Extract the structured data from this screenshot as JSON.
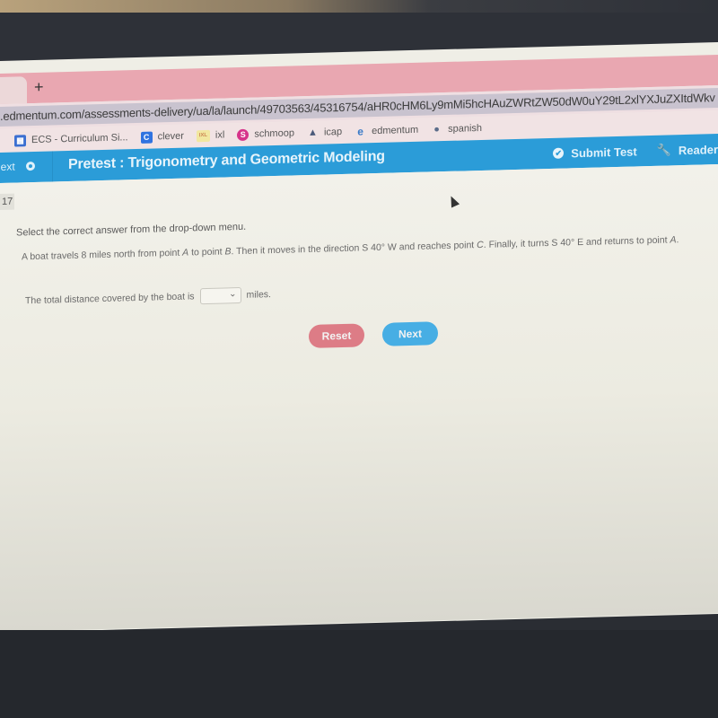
{
  "browser": {
    "tab_close_icon": "close-icon",
    "new_tab_icon": "plus-icon",
    "url": ".edmentum.com/assessments-delivery/ua/la/launch/49703563/45316754/aHR0cHM6Ly9mMi5hcHAuZWRtZW50dW0uY29tL2xlYXJuZXItdWkv",
    "bookmarks": [
      {
        "label": "ECS - Curriculum Si...",
        "icon": "calendar-icon",
        "color": "#3b6fd1",
        "glyph": "▦"
      },
      {
        "label": "clever",
        "icon": "clever-icon",
        "color": "#2f73e0",
        "glyph": "C"
      },
      {
        "label": "ixl",
        "icon": "ixl-icon",
        "color": "#e4c04b",
        "glyph": "IXL"
      },
      {
        "label": "schmoop",
        "icon": "schmoop-icon",
        "color": "#d6338a",
        "glyph": "S"
      },
      {
        "label": "icap",
        "icon": "graduation-cap-icon",
        "color": "#4b5a7a",
        "glyph": "🎓"
      },
      {
        "label": "edmentum",
        "icon": "edmentum-icon",
        "color": "#3a7bc8",
        "glyph": "e"
      },
      {
        "label": "spanish",
        "icon": "chat-bubble-icon",
        "color": "#5b6d8a",
        "glyph": "💬"
      }
    ]
  },
  "header": {
    "next_label": "Next",
    "title": "Pretest : Trigonometry and Geometric Modeling",
    "submit_label": "Submit Test",
    "reader_label": "Reader",
    "brand_color": "#2b9cd8"
  },
  "question": {
    "number": "17",
    "instruction": "Select the correct answer from the drop-down menu.",
    "text_part1": "A boat travels 8 miles north from point ",
    "point_a": "A",
    "text_part2": " to point ",
    "point_b": "B",
    "text_part3": ". Then it moves in the direction S 40° W and reaches point ",
    "point_c": "C",
    "text_part4": ". Finally, it turns S 40° E  and returns to point ",
    "point_a2": "A",
    "text_part5": ".",
    "answer_prefix": "The total distance covered by the boat is",
    "answer_selected": "",
    "answer_suffix": "miles."
  },
  "buttons": {
    "reset_label": "Reset",
    "next_label": "Next",
    "reset_color": "#dd7c86",
    "next_color": "#47aee4"
  }
}
